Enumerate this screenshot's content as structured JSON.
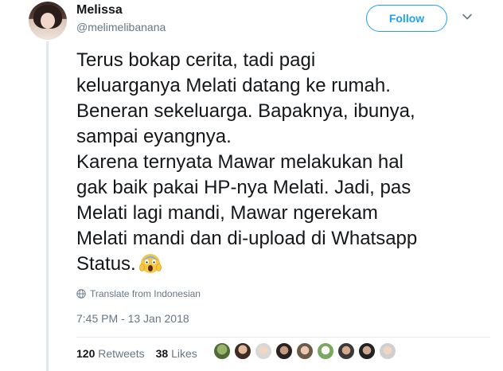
{
  "author": {
    "display_name": "Melissa",
    "handle": "@melimelibanana"
  },
  "header": {
    "follow_label": "Follow"
  },
  "tweet": {
    "lines": [
      "Terus bokap cerita, tadi pagi",
      "keluarganya Melati datang ke rumah.",
      "Beneran sekeluarga. Bapaknya, ibunya,",
      "sampai eyangnya.",
      "Karena ternyata Mawar melakukan hal",
      "gak baik pakai HP-nya Melati. Jadi, pas",
      "Melati lagi mandi, Mawar ngerekam",
      "Melati mandi dan di-upload di Whatsapp",
      "Status."
    ],
    "emoji": "face-screaming-in-fear-icon",
    "translate_label": "Translate from Indonesian",
    "timestamp": "7:45 PM - 13 Jan 2018"
  },
  "stats": {
    "retweets_count": "120",
    "retweets_label": "Retweets",
    "likes_count": "38",
    "likes_label": "Likes"
  },
  "colors": {
    "accent": "#1da1f2",
    "secondary_text": "#657786",
    "primary_text": "#14171a",
    "thread_line": "#e1e8ed"
  }
}
